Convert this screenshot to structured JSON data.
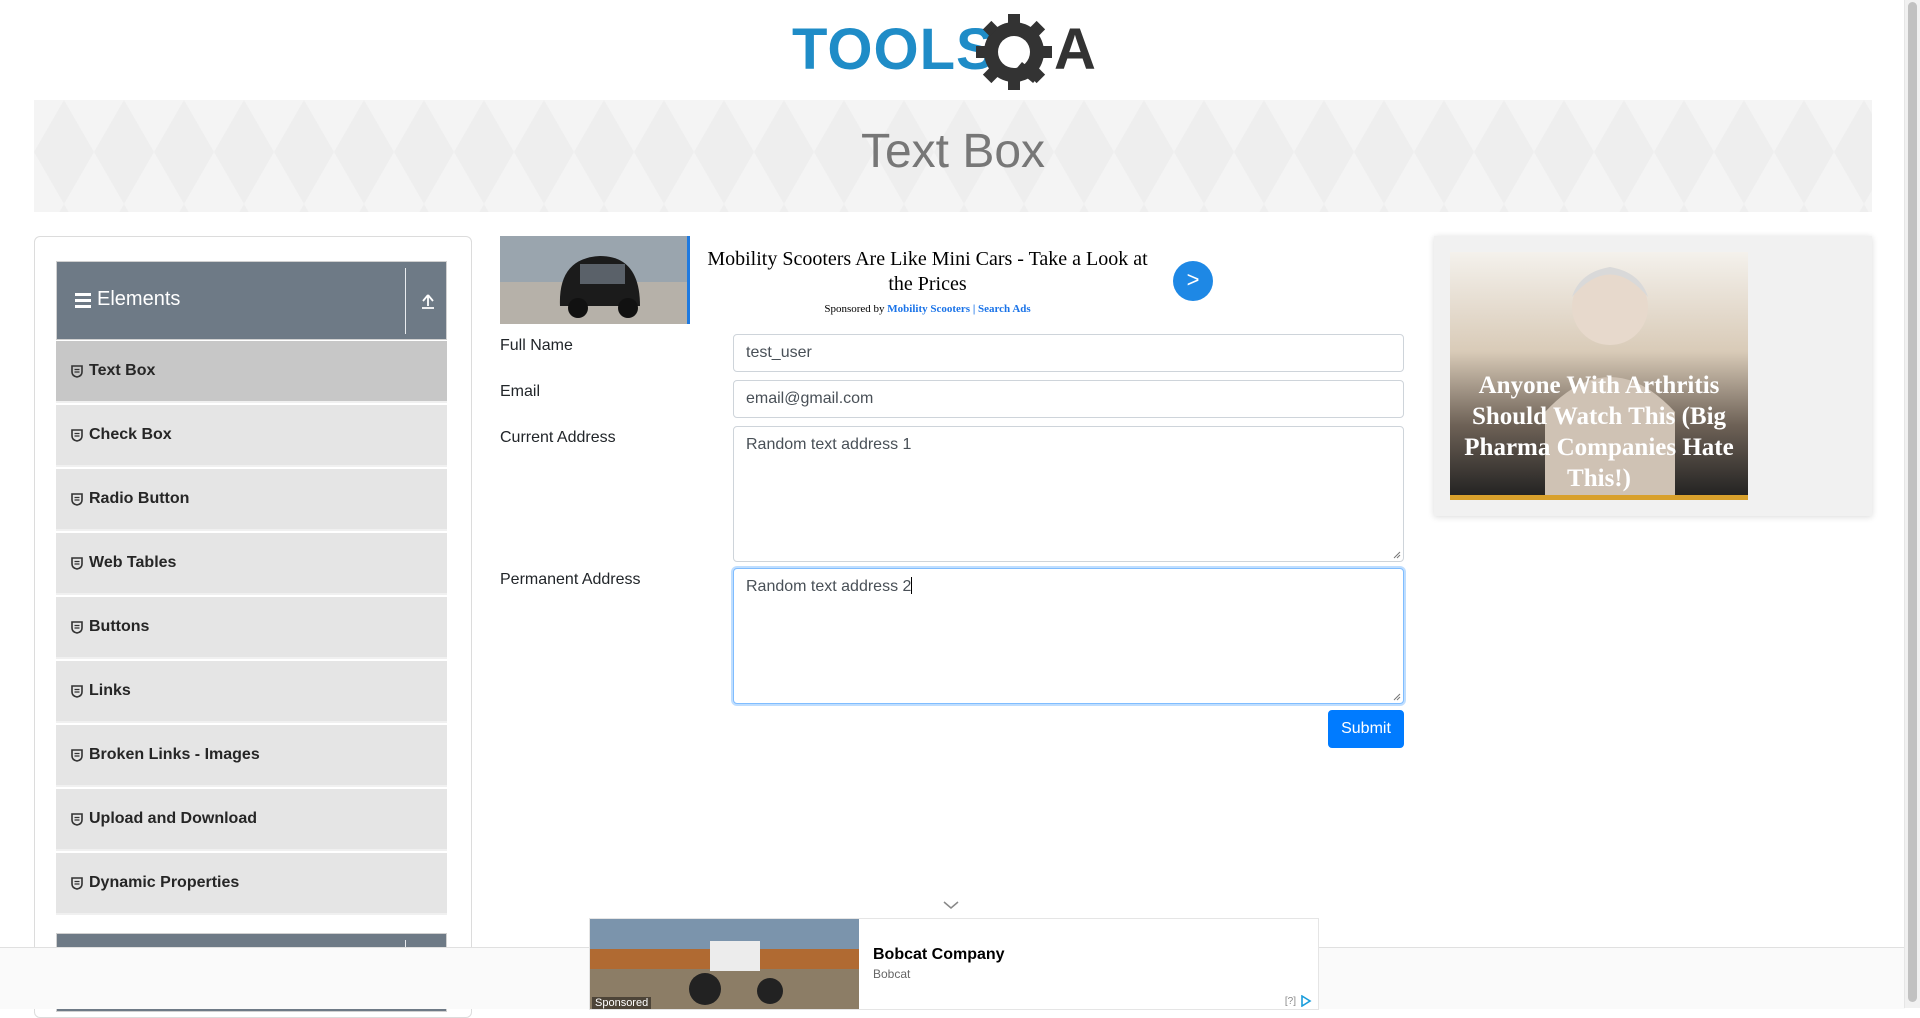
{
  "header": {
    "logo_text": "TOOLSQA"
  },
  "banner": {
    "title": "Text Box"
  },
  "sidebar": {
    "group_title": "Elements",
    "items": [
      {
        "label": "Text Box"
      },
      {
        "label": "Check Box"
      },
      {
        "label": "Radio Button"
      },
      {
        "label": "Web Tables"
      },
      {
        "label": "Buttons"
      },
      {
        "label": "Links"
      },
      {
        "label": "Broken Links - Images"
      },
      {
        "label": "Upload and Download"
      },
      {
        "label": "Dynamic Properties"
      }
    ]
  },
  "ad_top": {
    "headline": "Mobility Scooters Are Like Mini Cars - Take a Look at the Prices",
    "sponsored_prefix": "Sponsored by",
    "sponsor": "Mobility Scooters | Search Ads",
    "cta": ">"
  },
  "form": {
    "full_name_label": "Full Name",
    "full_name_value": "test_user",
    "email_label": "Email",
    "email_value": "email@gmail.com",
    "current_address_label": "Current Address",
    "current_address_value": "Random text address 1",
    "permanent_address_label": "Permanent Address",
    "permanent_address_value": "Random text address 2",
    "submit_label": "Submit"
  },
  "ad_right": {
    "caption": "Anyone With Arthritis Should Watch This (Big Pharma Companies Hate This!)"
  },
  "ad_bottom": {
    "sponsored_tag": "Sponsored",
    "company": "Bobcat Company",
    "brand": "Bobcat",
    "adchoices": "[?]"
  }
}
